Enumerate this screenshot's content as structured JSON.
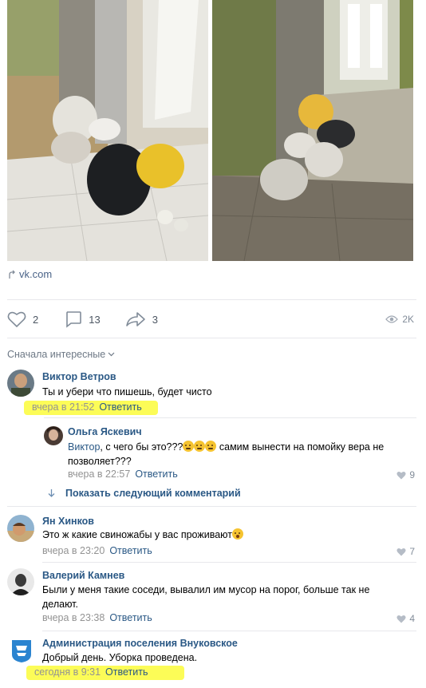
{
  "post": {
    "link_label": "vk.com",
    "likes": "2",
    "comments": "13",
    "shares": "3",
    "views": "2K"
  },
  "comments_section": {
    "sort_label": "Сначала интересные",
    "show_more_label": "Показать следующий комментарий",
    "items": [
      {
        "author": "Виктор Ветров",
        "text": "Ты и убери что пишешь, будет чисто",
        "time": "вчера в 21:52",
        "reply": "Ответить"
      },
      {
        "author": "Ольга Яскевич",
        "mention": "Виктор",
        "text_a": ", с чего бы это???",
        "text_b": " самим вынести на помойку вера не позволяет???",
        "time": "вчера в 22:57",
        "reply": "Ответить",
        "likes": "9"
      },
      {
        "author": "Ян Хинков",
        "text": "Это ж какие свиножабы у вас проживают",
        "time": "вчера в 23:20",
        "reply": "Ответить",
        "likes": "7"
      },
      {
        "author": "Валерий Камнев",
        "text": "Были у меня такие соседи, вывалил им мусор на порог, больше так не делают.",
        "time": "вчера в 23:38",
        "reply": "Ответить",
        "likes": "4"
      },
      {
        "author": "Администрация поселения Внуковское",
        "text": "Добрый день. Уборка проведена.",
        "time": "сегодня в 9:31",
        "reply": "Ответить"
      }
    ]
  },
  "colors": {
    "link": "#2a5885",
    "highlight": "#fbfc3a",
    "muted": "#939393"
  }
}
